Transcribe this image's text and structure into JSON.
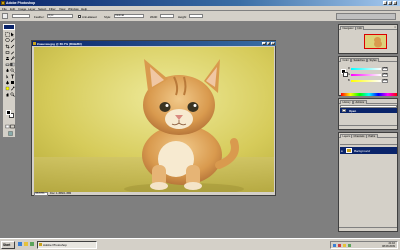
{
  "app": {
    "title": "Adobe Photoshop",
    "window_buttons": {
      "minimize": "_",
      "maximize": "□",
      "close": "×"
    }
  },
  "menu": [
    "File",
    "Edit",
    "Image",
    "Layer",
    "Select",
    "Filter",
    "View",
    "Window",
    "Help"
  ],
  "options": {
    "feather_label": "Feather:",
    "feather_value": "0 px",
    "antialias_label": "Anti-aliased",
    "style_label": "Style:",
    "style_value": "Normal",
    "width_label": "Width:",
    "height_label": "Height:"
  },
  "document": {
    "title": "Кошечка.jpg @ 66.7% (RGB/8#)",
    "zoom": "66.67%",
    "info": "Doc: 1.45M/1.45M",
    "buttons": {
      "minimize": "_",
      "maximize": "□",
      "close": "×"
    }
  },
  "navigator": {
    "tabs": [
      "Navigator",
      "Info"
    ]
  },
  "color": {
    "tabs": [
      "Color",
      "Swatches",
      "Styles"
    ],
    "channels": [
      {
        "label": "R",
        "value": "255"
      },
      {
        "label": "G",
        "value": "255"
      },
      {
        "label": "B",
        "value": "255"
      }
    ]
  },
  "history": {
    "tabs": [
      "History",
      "Actions"
    ],
    "item": "Open"
  },
  "layers": {
    "tabs": [
      "Layers",
      "Channels",
      "Paths"
    ],
    "item": "Background"
  },
  "taskbar": {
    "start": "Start",
    "task": "Adobe Photoshop",
    "clock_time": "21:16",
    "clock_date": "08.08.2009"
  }
}
